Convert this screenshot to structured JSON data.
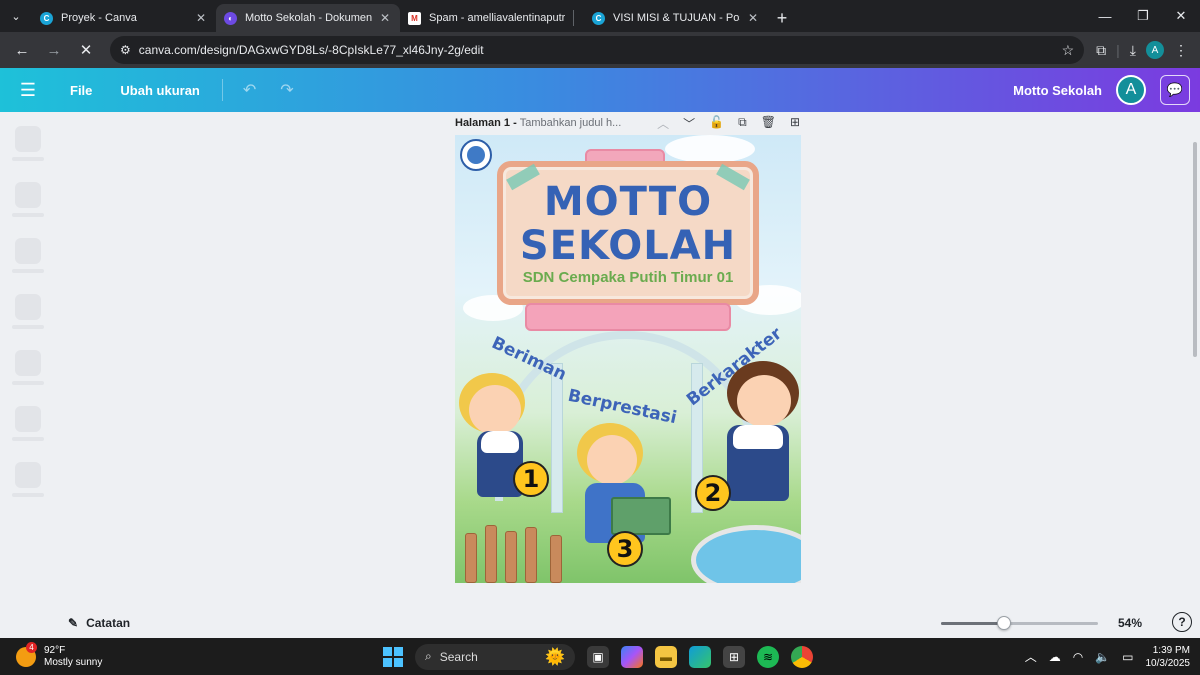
{
  "browser": {
    "tabs": [
      {
        "title": "Proyek - Canva",
        "favicon": "canva-icon",
        "active": false
      },
      {
        "title": "Motto Sekolah - Dokumen",
        "favicon": "canva-docs-icon",
        "active": true
      },
      {
        "title": "Spam - amelliavalentinaputrian",
        "favicon": "gmail-icon",
        "active": false
      },
      {
        "title": "VISI MISI & TUJUAN - Poster (A",
        "favicon": "canva-icon",
        "active": false
      }
    ],
    "url": "canva.com/design/DAGxwGYD8Ls/-8CpIskLe77_xl46Jny-2g/edit",
    "profile_initial": "A"
  },
  "canva": {
    "menu_file": "File",
    "menu_resize": "Ubah ukuran",
    "doc_title": "Motto Sekolah",
    "avatar_initial": "A",
    "page_label": "Halaman 1 -",
    "page_subtitle": "Tambahkan judul h...",
    "notes_label": "Catatan",
    "zoom": "54%",
    "zoom_fraction": 0.4,
    "help": "?"
  },
  "poster": {
    "title_line1": "MOTTO",
    "title_line2": "SEKOLAH",
    "school": "SDN Cempaka Putih Timur 01",
    "labels": [
      "Beriman",
      "Berprestasi",
      "Berkarakter"
    ],
    "numbers": [
      "1",
      "3",
      "2"
    ]
  },
  "taskbar": {
    "temperature": "92°F",
    "weather": "Mostly sunny",
    "weather_badge": "4",
    "search": "Search",
    "time": "1:39 PM",
    "date": "10/3/2025"
  },
  "colors": {
    "canva_gradient_start": "#1ec1d9",
    "canva_gradient_end": "#7b3be0",
    "poster_title": "#3562b5",
    "poster_school": "#6aab4e",
    "number_badge": "#ffc51e"
  }
}
